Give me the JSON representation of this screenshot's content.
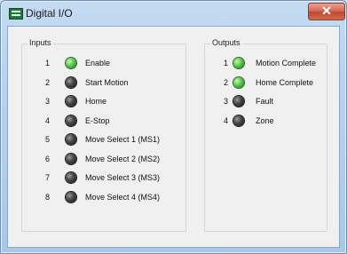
{
  "window": {
    "title": "Digital I/O",
    "close_glyph": "✕",
    "app_icon": "digital-io-icon"
  },
  "colors": {
    "led_on": "#5fc856",
    "led_off": "#2a2a2a"
  },
  "inputs": {
    "label": "Inputs",
    "items": [
      {
        "num": "1",
        "label": "Enable",
        "state": "on"
      },
      {
        "num": "2",
        "label": "Start Motion",
        "state": "off"
      },
      {
        "num": "3",
        "label": "Home",
        "state": "off"
      },
      {
        "num": "4",
        "label": "E-Stop",
        "state": "off"
      },
      {
        "num": "5",
        "label": "Move Select 1 (MS1)",
        "state": "off"
      },
      {
        "num": "6",
        "label": "Move Select 2 (MS2)",
        "state": "off"
      },
      {
        "num": "7",
        "label": "Move Select 3 (MS3)",
        "state": "off"
      },
      {
        "num": "8",
        "label": "Move Select 4 (MS4)",
        "state": "off"
      }
    ]
  },
  "outputs": {
    "label": "Outputs",
    "items": [
      {
        "num": "1",
        "label": "Motion Complete",
        "state": "on"
      },
      {
        "num": "2",
        "label": "Home Complete",
        "state": "on"
      },
      {
        "num": "3",
        "label": "Fault",
        "state": "off"
      },
      {
        "num": "4",
        "label": "Zone",
        "state": "off"
      }
    ]
  }
}
